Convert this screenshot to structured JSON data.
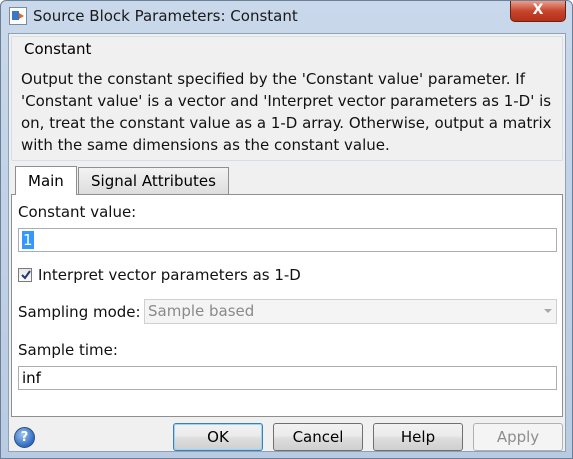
{
  "window": {
    "title": "Source Block Parameters: Constant",
    "close_glyph": "X"
  },
  "block": {
    "name": "Constant",
    "description": "Output the constant specified by the 'Constant value' parameter. If 'Constant value' is a vector and 'Interpret vector parameters as 1-D' is on, treat the constant value as a 1-D array. Otherwise, output a matrix with the same dimensions as the constant value."
  },
  "tabs": [
    {
      "label": "Main",
      "active": true
    },
    {
      "label": "Signal Attributes",
      "active": false
    }
  ],
  "main": {
    "constant_value_label": "Constant value:",
    "constant_value": "1",
    "interpret_label": "Interpret vector parameters as 1-D",
    "interpret_checked": true,
    "sampling_mode_label": "Sampling mode:",
    "sampling_mode_value": "Sample based",
    "sample_time_label": "Sample time:",
    "sample_time_value": "inf"
  },
  "buttons": {
    "help_glyph": "?",
    "ok": "OK",
    "cancel": "Cancel",
    "help": "Help",
    "apply": "Apply"
  },
  "icons": {
    "app": "simulink-block-icon",
    "help": "help-circle-icon",
    "close": "close-icon",
    "check": "check-icon",
    "dropdown": "chevron-down-icon"
  },
  "colors": {
    "selection": "#3399ff",
    "close_button": "#c7452c",
    "help_icon": "#2f6bc2"
  }
}
